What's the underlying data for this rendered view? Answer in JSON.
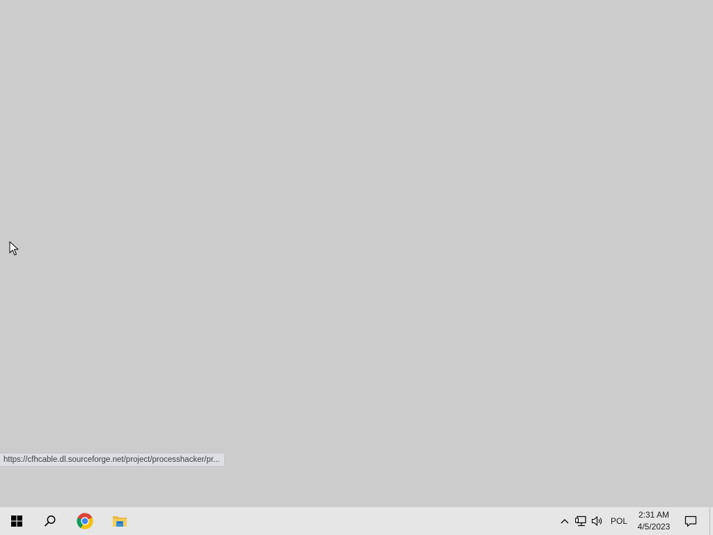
{
  "browser_status": {
    "link_url": "https://cfhcable.dl.sourceforge.net/project/processhacker/pr..."
  },
  "taskbar": {
    "buttons": [
      {
        "name": "Start",
        "icon": "windows-logo-icon"
      },
      {
        "name": "Search",
        "icon": "search-icon"
      },
      {
        "name": "Google Chrome",
        "icon": "chrome-icon"
      },
      {
        "name": "File Explorer",
        "icon": "folder-icon"
      }
    ],
    "tray": {
      "language": "POL",
      "time": "2:31 AM",
      "date": "4/5/2023"
    }
  },
  "colors": {
    "desktop_background": "#cccccc",
    "taskbar_background": "#e6e6e6"
  }
}
